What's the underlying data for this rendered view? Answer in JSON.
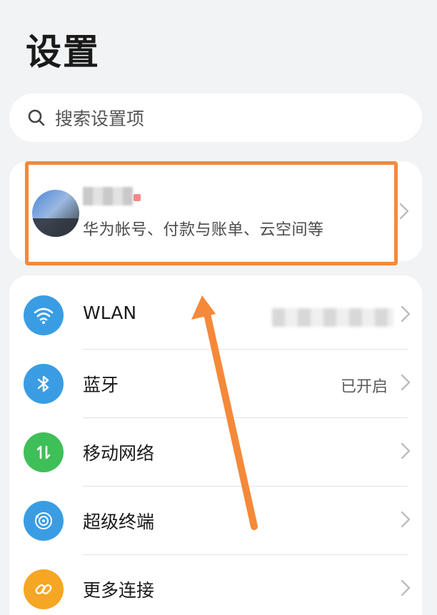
{
  "page": {
    "title": "设置"
  },
  "search": {
    "placeholder": "搜索设置项"
  },
  "account": {
    "subtitle": "华为帐号、付款与账单、云空间等"
  },
  "settings": [
    {
      "label": "WLAN",
      "value": "",
      "icon": "wifi-icon",
      "color": "#3a9de3"
    },
    {
      "label": "蓝牙",
      "value": "已开启",
      "icon": "bluetooth-icon",
      "color": "#3a9de3"
    },
    {
      "label": "移动网络",
      "value": "",
      "icon": "mobile-network-icon",
      "color": "#3fbf58"
    },
    {
      "label": "超级终端",
      "value": "",
      "icon": "super-device-icon",
      "color": "#3a9de3"
    },
    {
      "label": "更多连接",
      "value": "",
      "icon": "link-icon",
      "color": "#f5a623"
    }
  ],
  "colors": {
    "highlight": "#f5893a",
    "background": "#f1f3f5"
  }
}
